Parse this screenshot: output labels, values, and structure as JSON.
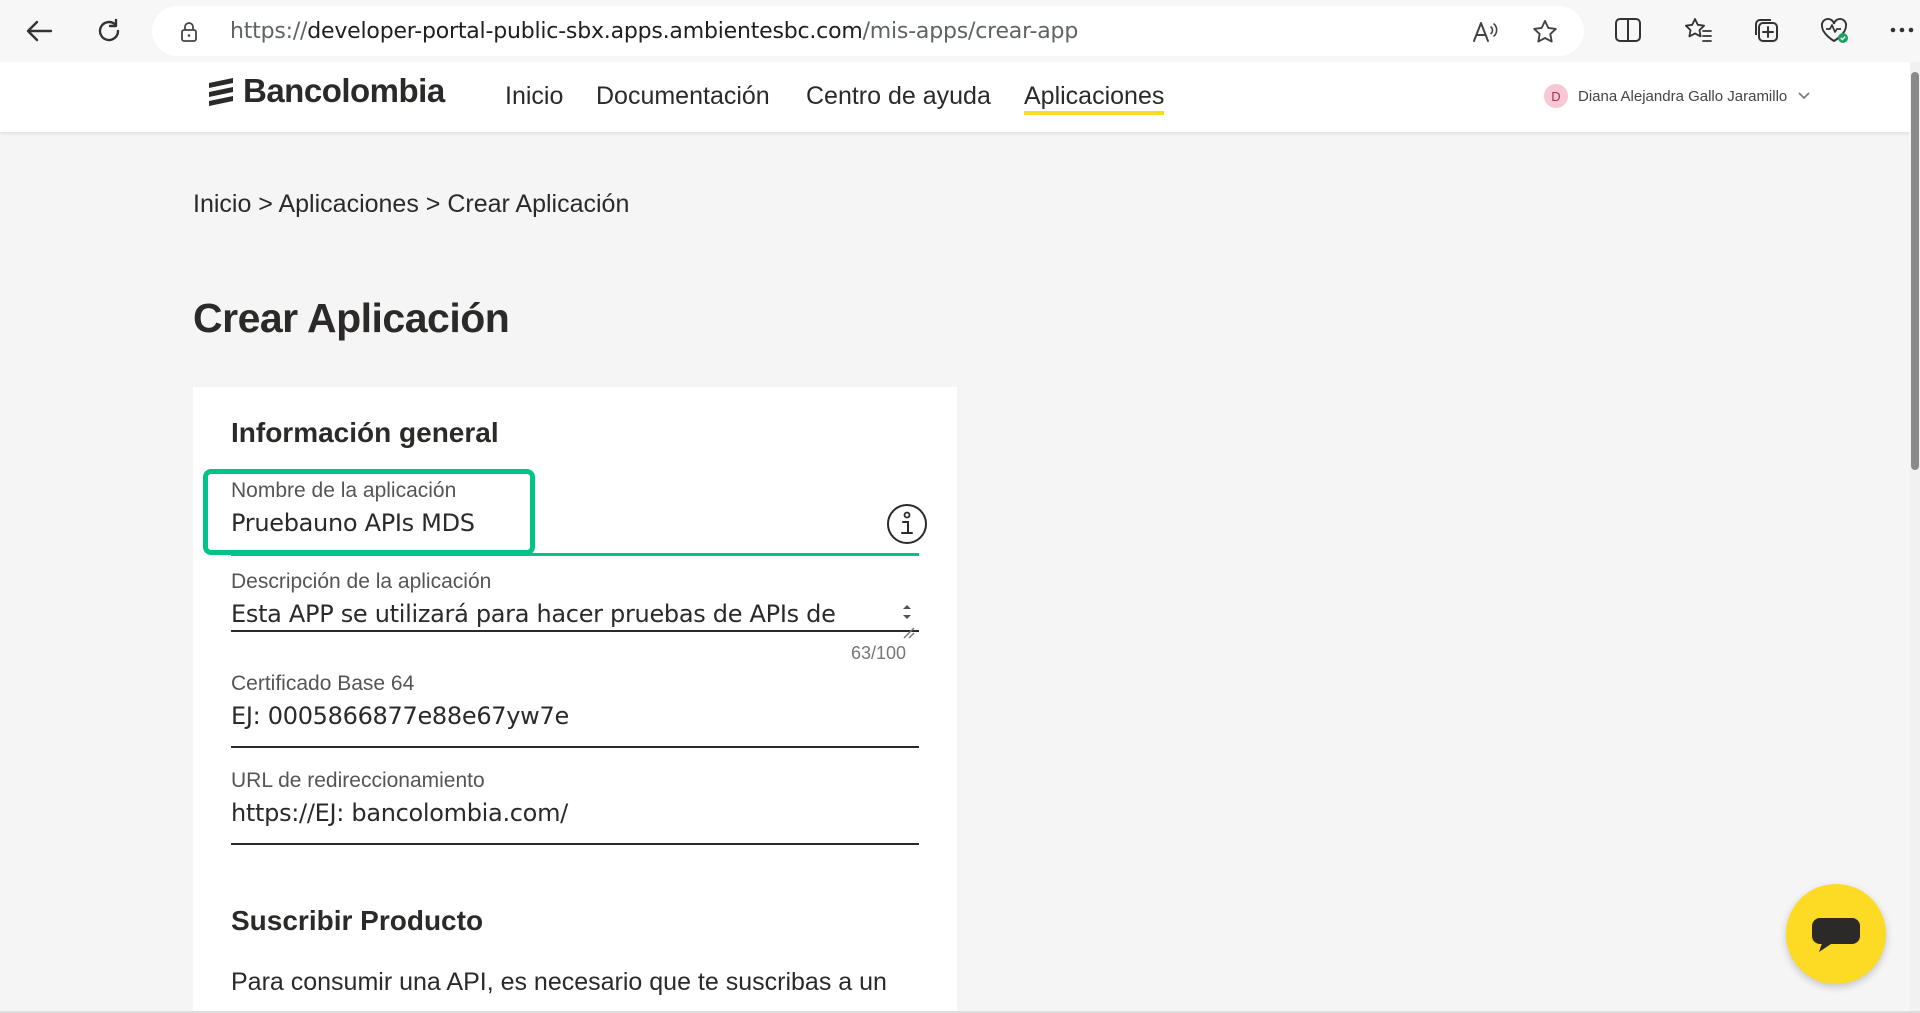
{
  "browser": {
    "url_prefix": "https://",
    "url_domain": "developer-portal-public-sbx.apps.ambientesbc.com",
    "url_path": "/mis-apps/crear-app"
  },
  "header": {
    "logo": "Bancolombia",
    "nav": [
      "Inicio",
      "Documentación",
      "Centro de ayuda",
      "Aplicaciones"
    ],
    "active_nav": "Aplicaciones",
    "user_initial": "D",
    "user_name": "Diana Alejandra Gallo Jaramillo"
  },
  "breadcrumb": "Inicio > Aplicaciones > Crear Aplicación",
  "page_title": "Crear Aplicación",
  "form": {
    "section_general": "Información general",
    "name_label": "Nombre de la aplicación",
    "name_value": "Pruebauno APIs MDS",
    "desc_label": "Descripción de la aplicación",
    "desc_value": "Esta APP se utilizará para hacer pruebas de APIs de",
    "desc_counter": "63/100",
    "cert_label": "Certificado Base 64",
    "cert_placeholder": "EJ: 0005866877e88e67yw7e",
    "url_label": "URL de redireccionamiento",
    "url_placeholder": "https://EJ: bancolombia.com/",
    "section_subscribe": "Suscribir Producto",
    "subscribe_text": "Para consumir una API, es necesario que te suscribas a un"
  },
  "colors": {
    "accent_green": "#00c389",
    "brand_yellow": "#fdda24"
  }
}
